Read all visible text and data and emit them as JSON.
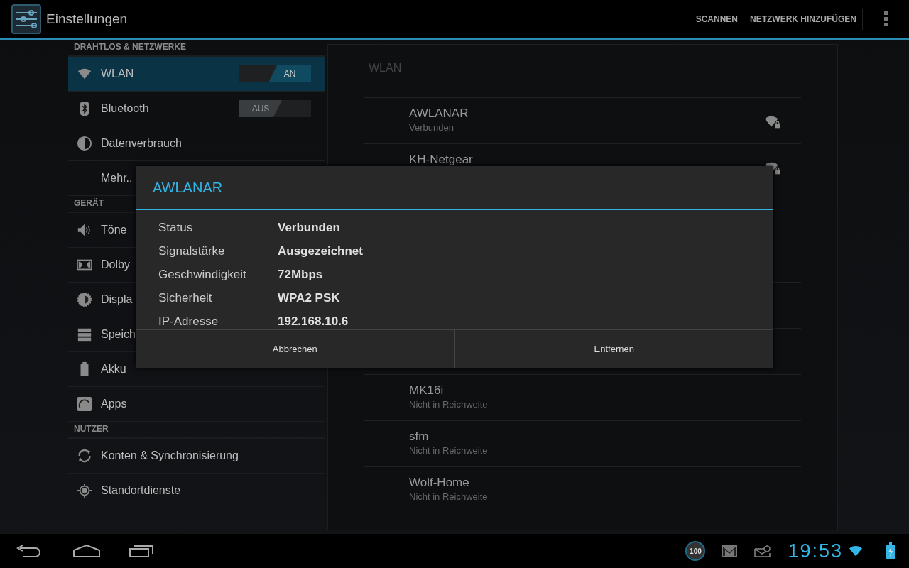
{
  "action_bar": {
    "title": "Einstellungen",
    "actions": [
      "SCANNEN",
      "NETZWERK HINZUFÜGEN"
    ]
  },
  "sidebar": {
    "sections": [
      {
        "header": "DRAHTLOS & NETZWERKE",
        "items": [
          {
            "label": "WLAN",
            "selected": true,
            "toggle": {
              "label": "AN",
              "on": true
            }
          },
          {
            "label": "Bluetooth",
            "selected": false,
            "toggle": {
              "label": "AUS",
              "on": false
            }
          },
          {
            "label": "Datenverbrauch",
            "selected": false
          },
          {
            "label": "Mehr..",
            "selected": false
          }
        ]
      },
      {
        "header": "GERÄT",
        "items": [
          {
            "label": "Töne",
            "selected": false
          },
          {
            "label": "Dolby",
            "selected": false
          },
          {
            "label": "Displa",
            "selected": false
          },
          {
            "label": "Speich",
            "selected": false
          },
          {
            "label": "Akku",
            "selected": false
          },
          {
            "label": "Apps",
            "selected": false
          }
        ]
      },
      {
        "header": "NUTZER",
        "items": [
          {
            "label": "Konten & Synchronisierung",
            "selected": false
          },
          {
            "label": "Standortdienste",
            "selected": false
          }
        ]
      }
    ]
  },
  "wlan_panel": {
    "title": "WLAN",
    "networks_top": [
      {
        "name": "AWLANAR",
        "status": "Verbunden"
      },
      {
        "name": "KH-Netgear"
      }
    ],
    "networks_bottom": [
      {
        "name": "MK16i",
        "status": "Nicht in Reichweite"
      },
      {
        "name": "sfm",
        "status": "Nicht in Reichweite"
      },
      {
        "name": "Wolf-Home",
        "status": "Nicht in Reichweite"
      }
    ]
  },
  "dialog": {
    "title": "AWLANAR",
    "fields": [
      {
        "label": "Status",
        "value": "Verbunden"
      },
      {
        "label": "Signalstärke",
        "value": "Ausgezeichnet"
      },
      {
        "label": "Geschwindigkeit",
        "value": "72Mbps"
      },
      {
        "label": "Sicherheit",
        "value": "WPA2 PSK"
      },
      {
        "label": "IP-Adresse",
        "value": "192.168.10.6"
      }
    ],
    "buttons": [
      "Abbrechen",
      "Entfernen"
    ]
  },
  "system_bar": {
    "badge": "100",
    "clock": "19:53"
  }
}
